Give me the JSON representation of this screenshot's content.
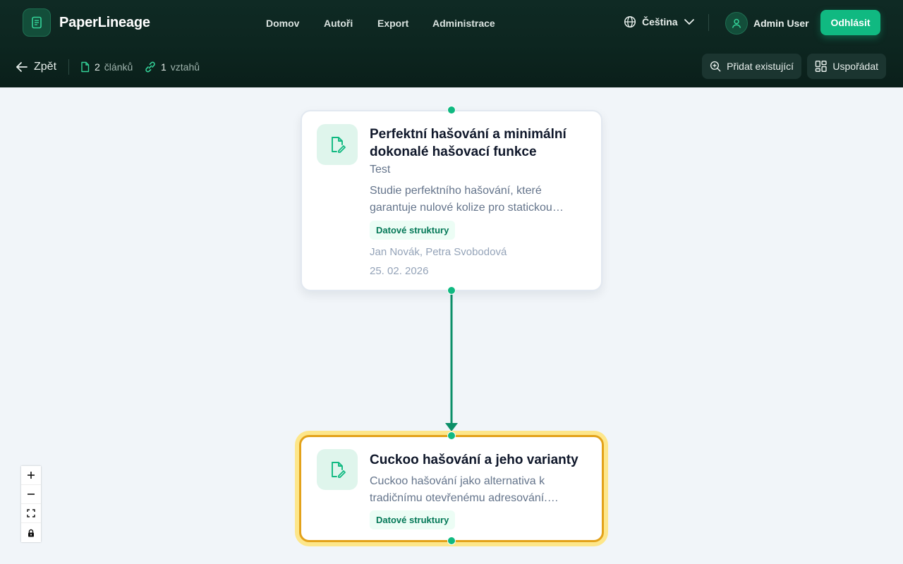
{
  "app": {
    "title": "PaperLineage"
  },
  "nav": {
    "items": [
      {
        "label": "Domov"
      },
      {
        "label": "Autoři"
      },
      {
        "label": "Export"
      },
      {
        "label": "Administrace"
      }
    ]
  },
  "language": {
    "label": "Čeština"
  },
  "user": {
    "name": "Admin User"
  },
  "logout_label": "Odhlásit",
  "toolbar": {
    "back_label": "Zpět",
    "articles": {
      "count": "2",
      "label": "článků"
    },
    "relations": {
      "count": "1",
      "label": "vztahů"
    },
    "add_existing_label": "Přidat existující",
    "arrange_label": "Uspořádat"
  },
  "graph": {
    "nodes": [
      {
        "title": "Perfektní hašování a minimální dokonalé hašovací funkce",
        "venue": "Test",
        "abstract": "Studie perfektního hašování, které garantuje nulové kolize pro statickou…",
        "tag": "Datové struktury",
        "authors": "Jan Novák, Petra Svobodová",
        "date": "25. 02. 2026",
        "selected": false
      },
      {
        "title": "Cuckoo hašování a jeho varianty",
        "abstract": "Cuckoo hašování jako alternativa k tradičnímu otevřenému adresování.…",
        "tag": "Datové struktury",
        "selected": true
      }
    ],
    "edges": [
      {
        "from": 0,
        "to": 1
      }
    ]
  },
  "colors": {
    "accent": "#10b981",
    "header_bg": "#0d2620",
    "selected_border": "#e3a21a",
    "selected_glow": "#fde68a",
    "edge": "#0b8f68"
  },
  "zoom_controls": [
    "zoom-in-icon",
    "zoom-out-icon",
    "fit-view-icon",
    "lock-icon"
  ]
}
